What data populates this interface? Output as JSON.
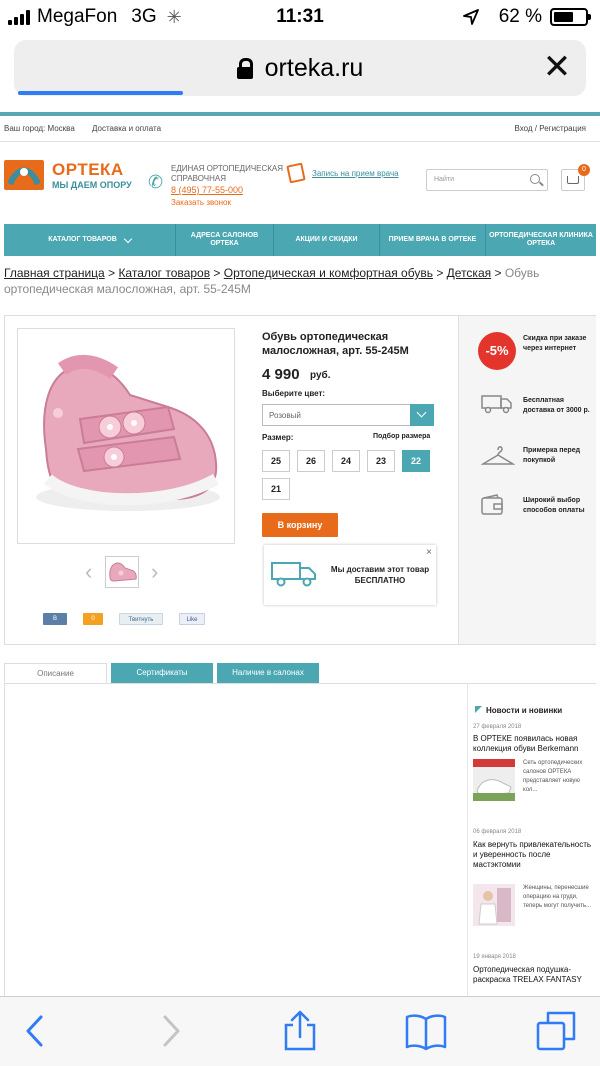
{
  "status_bar": {
    "carrier": "MegaFon",
    "network": "3G",
    "time": "11:31",
    "battery_percent": "62 %",
    "battery_level": 0.62
  },
  "browser": {
    "url": "orteka.ru",
    "load_progress": 0.29
  },
  "site": {
    "utility": {
      "city": "Ваш город: Москва",
      "delivery": "Доставка и оплата",
      "login": "Вход / Регистрация"
    },
    "logo": {
      "word": "ОРТЕКА",
      "slogan": "МЫ ДАЕМ ОПОРУ"
    },
    "info": {
      "label": "ЕДИНАЯ ОРТОПЕДИЧЕСКАЯ СПРАВОЧНАЯ",
      "phone": "8 (495) 77-55-000",
      "callback": "Заказать звонок"
    },
    "doctor_link": "Запись на прием врача",
    "search_placeholder": "Найти",
    "cart_count": "0",
    "nav": [
      "КАТАЛОГ ТОВАРОВ",
      "АДРЕСА САЛОНОВ ОРТЕКА",
      "АКЦИИ И СКИДКИ",
      "ПРИЕМ ВРАЧА В ОРТЕКЕ",
      "ОРТОПЕДИЧЕСКАЯ КЛИНИКА ОРТЕКА"
    ],
    "breadcrumb": {
      "links": [
        "Главная страница",
        "Каталог товаров",
        "Ортопедическая и комфортная обувь",
        "Детская"
      ],
      "separator": ">",
      "current": "Обувь ортопедическая малосложная, арт. 55-245M"
    }
  },
  "product": {
    "title": "Обувь ортопедическая малосложная, арт. 55-245M",
    "price": "4 990",
    "currency": "руб.",
    "color_label": "Выберите цвет:",
    "color_value": "Розовый",
    "size_label": "Размер:",
    "size_picker": "Подбор размера",
    "sizes": [
      "25",
      "26",
      "24",
      "23",
      "22",
      "21"
    ],
    "selected_size": "22",
    "add_to_cart": "В корзину",
    "promo_text": "Мы доставим этот товар БЕСПЛАТНО",
    "promo_close": "×",
    "social": [
      "В",
      "0",
      "Твитнуть",
      "Like"
    ]
  },
  "benefits": {
    "discount_badge": "-5%",
    "items": [
      "Скидка при заказе через интернет",
      "Бесплатная доставка от 3000 р.",
      "Примерка перед покупкой",
      "Широкий выбор способов оплаты"
    ]
  },
  "tabs": [
    "Описание",
    "Сертификаты",
    "Наличие в салонах"
  ],
  "news": {
    "heading": "Новости и новинки",
    "items": [
      {
        "date": "27 февраля 2018",
        "title": "В ОРТЕКЕ появилась новая коллекция обуви Berkemann",
        "snippet": "Сеть ортопедических салонов ОРТЕКА представляет новую кол..."
      },
      {
        "date": "06 февраля 2018",
        "title": "Как вернуть привлекательность и уверенность после мастэктомии",
        "snippet": "Женщины, перенесшие операцию на груди, теперь могут получить..."
      },
      {
        "date": "19 января 2018",
        "title": "Ортопедическая подушка-раскраска TRELAX FANTASY",
        "snippet": ""
      }
    ]
  },
  "colors": {
    "accent_teal": "#4ba7b2",
    "brand_orange": "#e86b1b",
    "discount_red": "#e3352b",
    "ios_blue": "#2f7cf6"
  }
}
